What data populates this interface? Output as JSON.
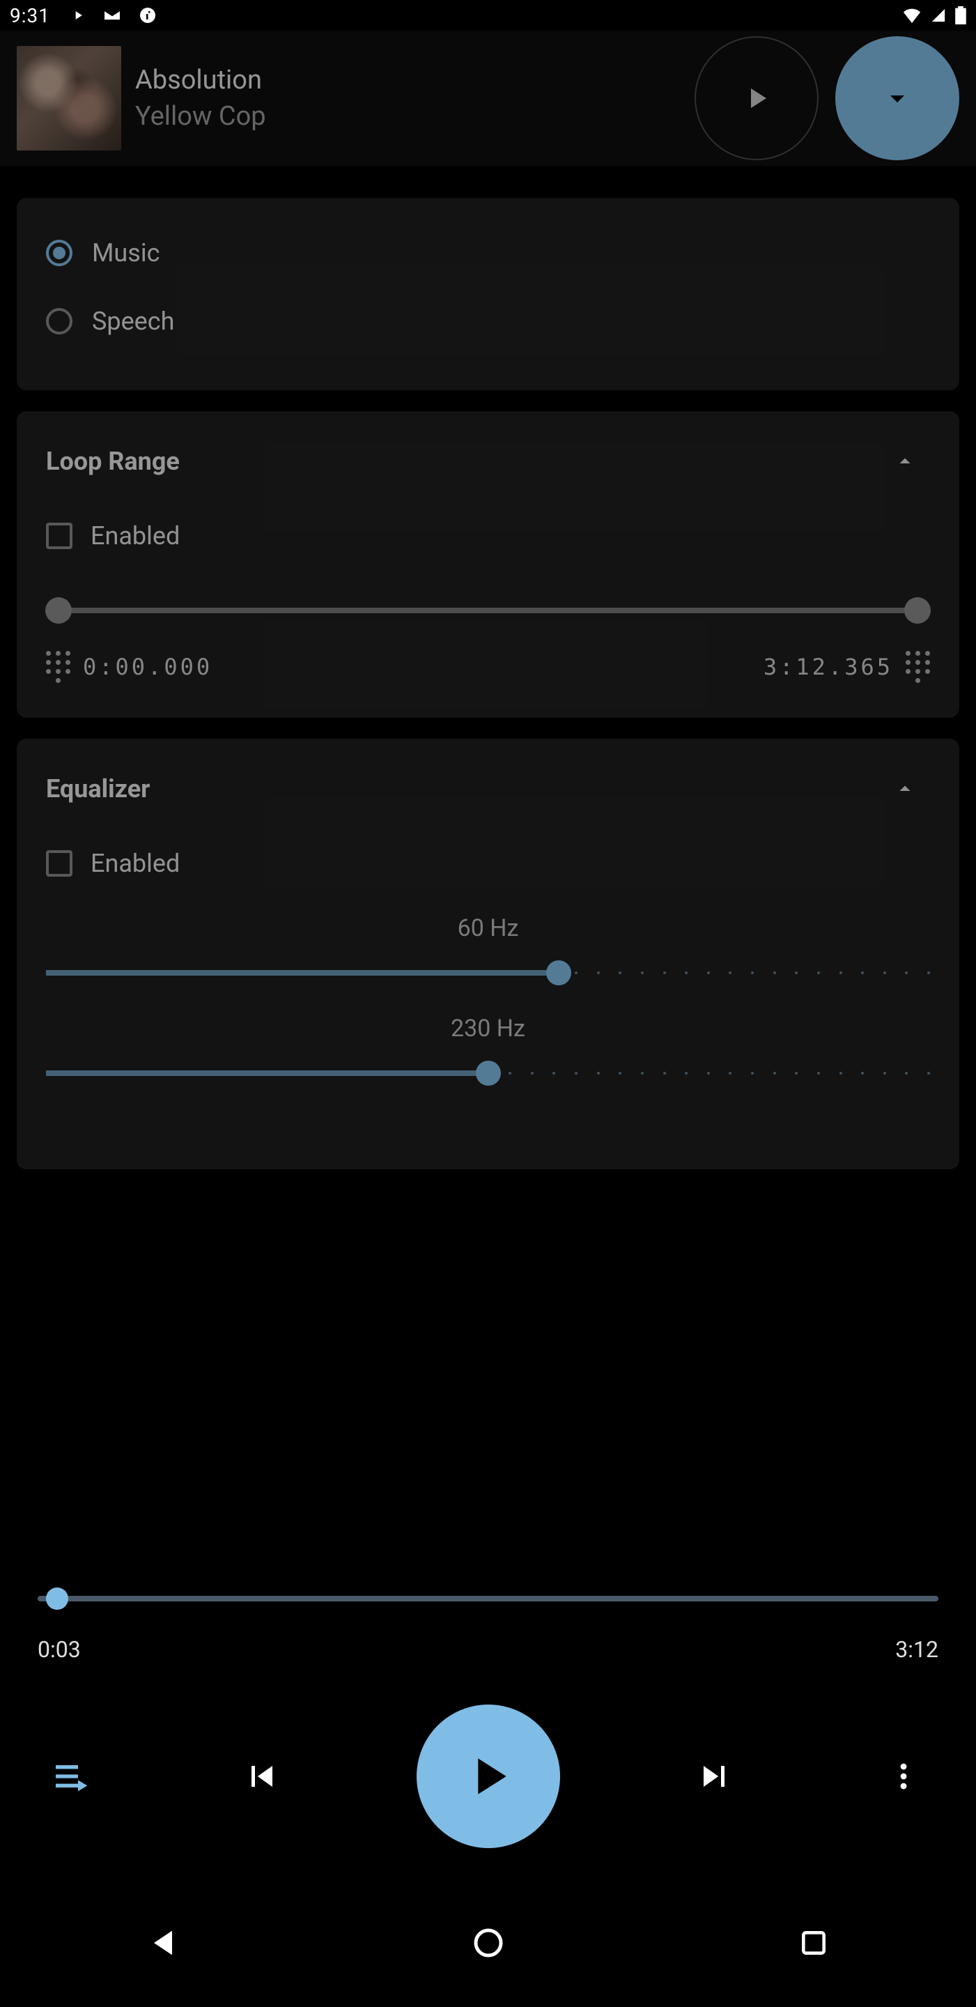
{
  "statusbar": {
    "time": "9:31"
  },
  "header": {
    "track_title": "Absolution",
    "track_artist": "Yellow Cop"
  },
  "type_section": {
    "option_music": "Music",
    "option_speech": "Speech",
    "selected": "music"
  },
  "loop": {
    "title": "Loop Range",
    "enabled_label": "Enabled",
    "start": "0:00.000",
    "end": "3:12.365"
  },
  "eq": {
    "title": "Equalizer",
    "enabled_label": "Enabled",
    "bands": [
      {
        "label": "60 Hz",
        "pos": 0.58
      },
      {
        "label": "230 Hz",
        "pos": 0.5
      }
    ]
  },
  "player": {
    "current": "0:03",
    "duration": "3:12",
    "seek_pos": 0.018
  },
  "chart_data": {
    "type": "table",
    "title": "Equalizer band positions (0–1)",
    "categories": [
      "60 Hz",
      "230 Hz"
    ],
    "values": [
      0.58,
      0.5
    ]
  }
}
